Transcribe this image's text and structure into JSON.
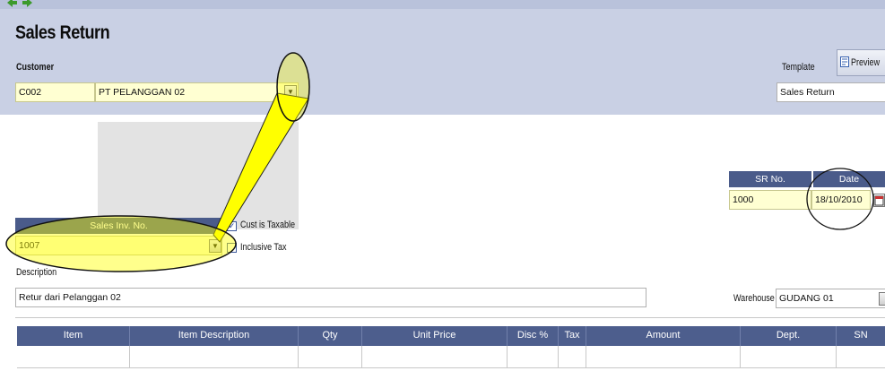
{
  "window": {
    "title": "Sales Return"
  },
  "customer": {
    "label": "Customer",
    "code": "C002",
    "name": "PT PELANGGAN 02"
  },
  "template": {
    "label": "Template",
    "preview_label": "Preview",
    "value": "Sales Return"
  },
  "sr": {
    "no_label": "SR No.",
    "date_label": "Date",
    "no_value": "1000",
    "date_value": "18/10/2010"
  },
  "invoice": {
    "header": "Sales Inv. No.",
    "value": "1007"
  },
  "options": {
    "cust_taxable_label": "Cust is Taxable",
    "cust_taxable_checked": true,
    "inclusive_tax_label": "Inclusive Tax",
    "inclusive_tax_checked": false
  },
  "description": {
    "label": "Description",
    "value": "Retur dari Pelanggan 02"
  },
  "warehouse": {
    "label": "Warehouse",
    "value": "GUDANG 01"
  },
  "grid": {
    "columns": [
      "Item",
      "Item Description",
      "Qty",
      "Unit Price",
      "Disc %",
      "Tax",
      "Amount",
      "Dept.",
      "SN"
    ]
  },
  "colors": {
    "header_band": "#c9d0e4",
    "field_bg": "#ffffd2",
    "grid_header": "#4d5e8d",
    "annotation": "#ffff00"
  }
}
